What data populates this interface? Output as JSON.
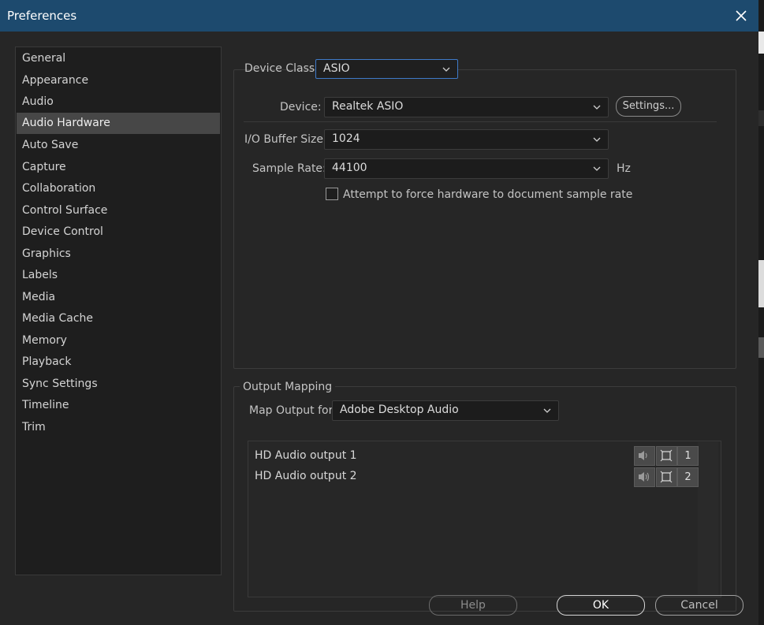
{
  "window": {
    "title": "Preferences",
    "close_icon": "close-icon"
  },
  "sidebar": {
    "items": [
      {
        "label": "General"
      },
      {
        "label": "Appearance"
      },
      {
        "label": "Audio"
      },
      {
        "label": "Audio Hardware",
        "selected": true
      },
      {
        "label": "Auto Save"
      },
      {
        "label": "Capture"
      },
      {
        "label": "Collaboration"
      },
      {
        "label": "Control Surface"
      },
      {
        "label": "Device Control"
      },
      {
        "label": "Graphics"
      },
      {
        "label": "Labels"
      },
      {
        "label": "Media"
      },
      {
        "label": "Media Cache"
      },
      {
        "label": "Memory"
      },
      {
        "label": "Playback"
      },
      {
        "label": "Sync Settings"
      },
      {
        "label": "Timeline"
      },
      {
        "label": "Trim"
      }
    ]
  },
  "hardware": {
    "device_class_label": "Device Class:",
    "device_class_value": "ASIO",
    "device_label": "Device:",
    "device_value": "Realtek ASIO",
    "settings_label": "Settings...",
    "buffer_label": "I/O Buffer Size:",
    "buffer_value": "1024",
    "rate_label": "Sample Rate:",
    "rate_value": "44100",
    "rate_unit": "Hz",
    "force_rate_label": "Attempt to force hardware to document sample rate",
    "force_rate_checked": false
  },
  "output_mapping": {
    "group_label": "Output Mapping",
    "map_for_label": "Map Output for:",
    "map_for_value": "Adobe Desktop Audio",
    "outputs": [
      {
        "label": "HD Audio output 1",
        "channel": "1"
      },
      {
        "label": "HD Audio output 2",
        "channel": "2"
      }
    ]
  },
  "footer": {
    "help_label": "Help",
    "ok_label": "OK",
    "cancel_label": "Cancel"
  },
  "colors": {
    "titlebar": "#1d4a6e",
    "background": "#262626",
    "selected_item": "#474747",
    "focus_border": "#3f7ac8"
  }
}
